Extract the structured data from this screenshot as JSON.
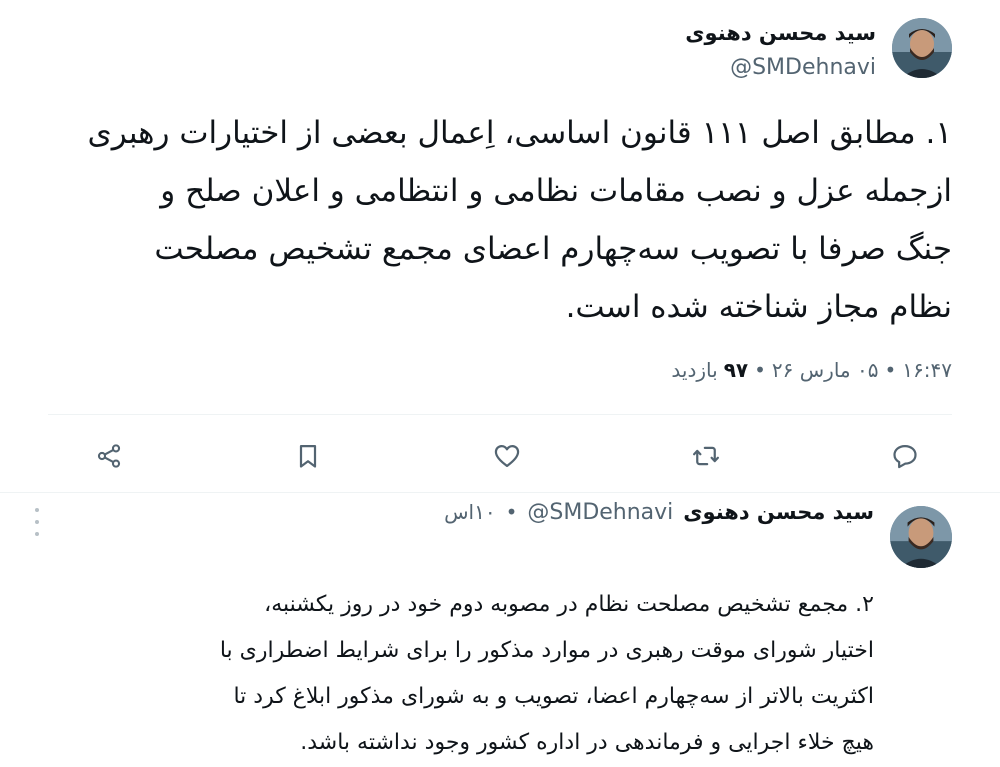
{
  "tweet1": {
    "author_name": "سید محسن دهنوی",
    "handle": "@SMDehnavi",
    "text": "۱. مطابق اصل ۱۱۱ قانون اساسی، اِعمال بعضی از اختیارات رهبری\nازجمله عزل و نصب مقامات نظامی و انتظامی و اعلان صلح و\nجنگ صرفا با تصویب سه‌چهارم اعضای مجمع تشخیص مصلحت\nنظام مجاز شناخته شده است.",
    "time": "۱۶:۴۷",
    "date": "۰۵ مارس ۲۶",
    "views_count": "۹۷",
    "views_label": "بازدید",
    "separator": "•"
  },
  "actions": [
    {
      "name": "share-icon"
    },
    {
      "name": "bookmark-icon"
    },
    {
      "name": "like-icon"
    },
    {
      "name": "retweet-icon"
    },
    {
      "name": "reply-icon"
    }
  ],
  "tweet2": {
    "author_name": "سید محسن دهنوی",
    "handle": "@SMDehnavi",
    "time": "۱۰اس",
    "separator": "•",
    "text": "۲. مجمع تشخیص مصلحت نظام در مصوبه دوم خود در روز یکشنبه،\nاختیار شورای موقت رهبری در موارد مذکور را برای شرایط اضطراری با\nاکثریت بالاتر از سه‌چهارم اعضا، تصویب و به شورای مذکور ابلاغ کرد تا\nهیچ خلاء اجرایی و فرماندهی در اداره کشور وجود نداشته باشد."
  },
  "colors": {
    "text": "#0f1419",
    "secondary": "#536471",
    "divider": "#eff3f4"
  }
}
